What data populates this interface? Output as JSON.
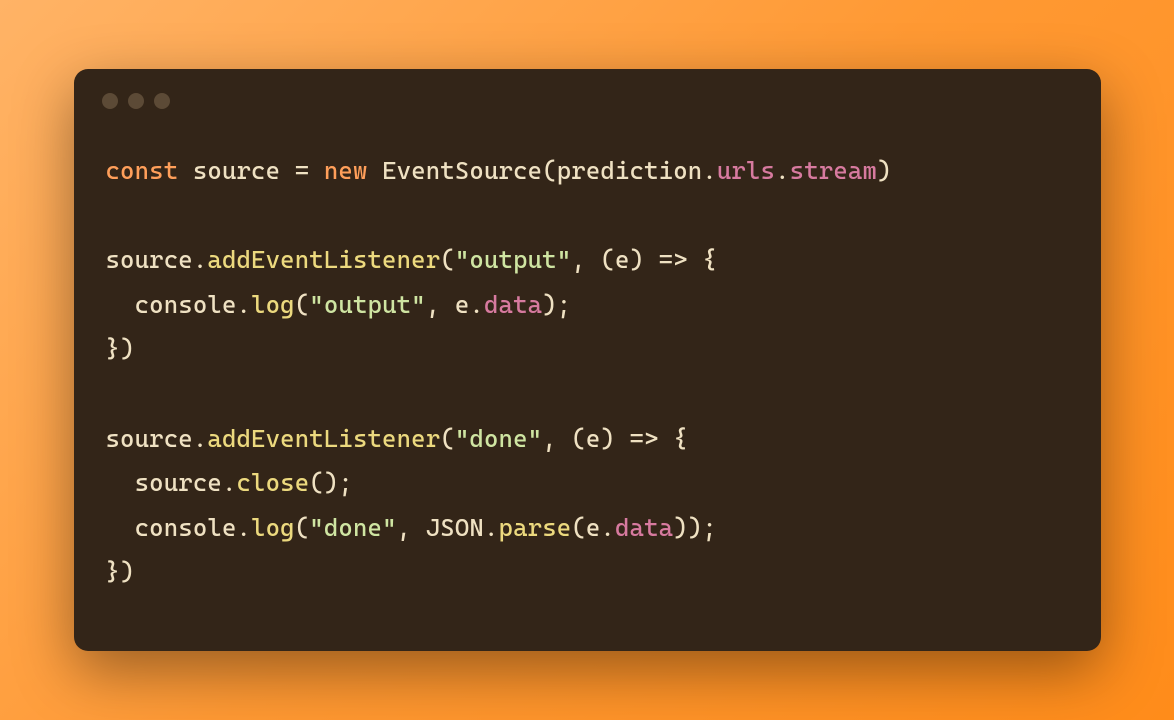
{
  "code": {
    "line1": {
      "t1": "const",
      "t2": " source ",
      "t3": "=",
      "t4": " ",
      "t5": "new",
      "t6": " EventSource(prediction.",
      "t7": "urls",
      "t8": ".",
      "t9": "stream",
      "t10": ")"
    },
    "line3": {
      "t1": "source.",
      "t2": "addEventListener",
      "t3": "(",
      "t4": "\"output\"",
      "t5": ", (e) ",
      "t6": "=>",
      "t7": " {"
    },
    "line4": {
      "t1": "  console.",
      "t2": "log",
      "t3": "(",
      "t4": "\"output\"",
      "t5": ", e.",
      "t6": "data",
      "t7": ");"
    },
    "line5": {
      "t1": "})"
    },
    "line7": {
      "t1": "source.",
      "t2": "addEventListener",
      "t3": "(",
      "t4": "\"done\"",
      "t5": ", (e) ",
      "t6": "=>",
      "t7": " {"
    },
    "line8": {
      "t1": "  source.",
      "t2": "close",
      "t3": "();"
    },
    "line9": {
      "t1": "  console.",
      "t2": "log",
      "t3": "(",
      "t4": "\"done\"",
      "t5": ", JSON.",
      "t6": "parse",
      "t7": "(e.",
      "t8": "data",
      "t9": "));"
    },
    "line10": {
      "t1": "})"
    }
  }
}
